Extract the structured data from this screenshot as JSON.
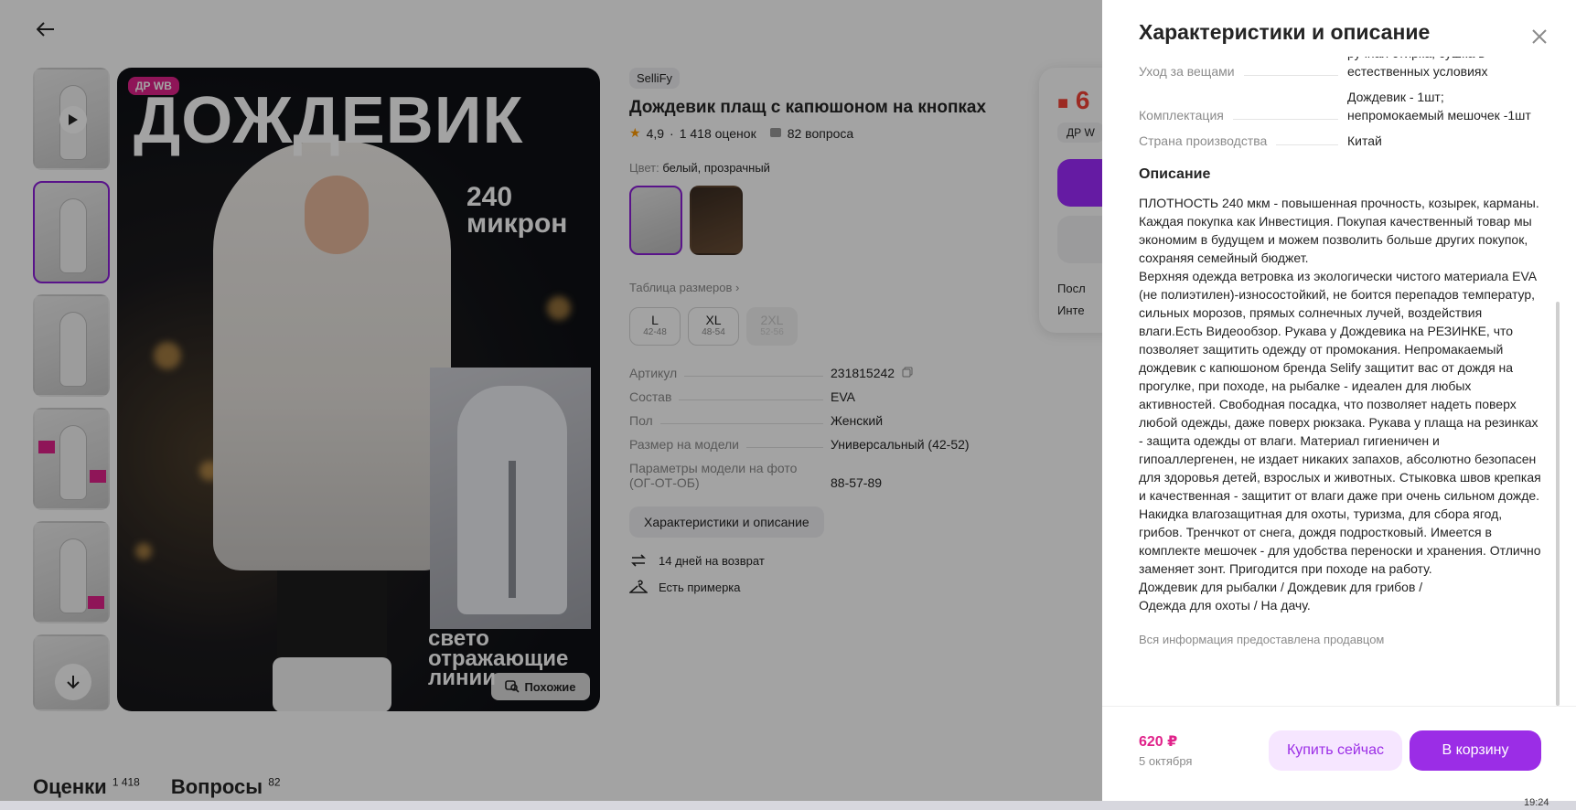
{
  "product": {
    "brand": "SelliFy",
    "title": "Дождевик плащ с капюшоном на кнопках",
    "rating": "4,9",
    "reviews": "1 418 оценок",
    "questions": "82 вопроса",
    "color_label": "Цвет:",
    "color_value": "белый, прозрачный",
    "size_table_link": "Таблица размеров",
    "sizes": [
      {
        "size": "L",
        "range": "42-48"
      },
      {
        "size": "XL",
        "range": "48-54"
      },
      {
        "size": "2XL",
        "range": "52-56"
      }
    ],
    "specs": [
      {
        "key": "Артикул",
        "value": "231815242"
      },
      {
        "key": "Состав",
        "value": "EVA"
      },
      {
        "key": "Пол",
        "value": "Женский"
      },
      {
        "key": "Размер на модели",
        "value": "Универсальный (42-52)"
      },
      {
        "key": "Параметры модели на фото (ОГ-ОТ-ОБ)",
        "value": "88-57-89"
      }
    ],
    "chars_button": "Характеристики и описание",
    "perks": [
      "14 дней на возврат",
      "Есть примерка"
    ],
    "photo_badge": "ДР WB",
    "photo_title": "ДОЖДЕВИК",
    "photo_micron": "240 микрон",
    "photo_lines": "свето отражающие линии",
    "similar_button": "Похожие",
    "buy_card": {
      "price_fragment": "6",
      "badge": "ДР W",
      "line1": "Посл",
      "line2": "Инте"
    },
    "bottom_tabs": [
      {
        "label": "Оценки",
        "count": "1 418"
      },
      {
        "label": "Вопросы",
        "count": "82"
      }
    ]
  },
  "drawer": {
    "title": "Характеристики и описание",
    "rows": [
      {
        "key": "Уход за вещами",
        "value": "ручная стирка, сушка в естественных условиях"
      },
      {
        "key": "Комплектация",
        "value": "Дождевик - 1шт; непромокаемый мешочек -1шт"
      },
      {
        "key": "Страна производства",
        "value": "Китай"
      }
    ],
    "description_heading": "Описание",
    "description": "ПЛОТНОСТЬ 240 мкм - повышенная прочность, козырек, карманы. Каждая покупка как Инвестиция. Покупая качественный товар мы экономим в будущем и можем позволить больше других покупок, сохраняя семейный бюджет.\nВерхняя одежда ветровка из экологически чистого материала EVA (не полиэтилен)-износостойкий, не боится перепадов температур, сильных морозов, прямых солнечных лучей, воздействия влаги.Есть Видеообзор. Рукава у Дождевика на РЕЗИНКЕ, что позволяет защитить одежду от промокания. Непромакаемый дождевик с капюшоном бренда Selify защитит вас от дождя на прогулке, при походе, на рыбалке - идеален для любых активностей. Свободная посадка, что позволяет надеть поверх любой одежды, даже поверх рюкзака. Рукава у плаща на резинках - защита одежды от влаги. Материал гигиеничен и гипоаллергенен, не издает никаких запахов, абсолютно безопасен для здоровья детей, взрослых и животных. Стыковка швов крепкая и качественная - защитит от влаги даже при очень сильном дожде. Накидка влагозащитная для охоты, туризма, для сбора ягод, грибов. Тренчкот от снега, дождя подростковый. Имеется в комплекте мешочек - для удобства переноски и хранения. Отлично заменяет зонт. Пригодится при походе на работу.\nДождевик для рыбалки / Дождевик для грибов /\nОдежда для охоты / На дачу.",
    "seller_note": "Вся информация предоставлена продавцом",
    "price": "620 ₽",
    "delivery": "5 октября",
    "buy_now": "Купить сейчас",
    "add_to_cart": "В корзину"
  },
  "taskbar": {
    "time": "19:24"
  },
  "colors": {
    "accent": "#9b2de6",
    "price": "#e0228a",
    "badge": "#e0228a"
  },
  "icons": [
    "back-arrow-icon",
    "close-icon",
    "star-icon",
    "question-icon",
    "copy-icon",
    "return-icon",
    "hanger-icon",
    "play-icon",
    "arrow-down-icon",
    "search-similar-icon",
    "chevron-right-icon"
  ]
}
